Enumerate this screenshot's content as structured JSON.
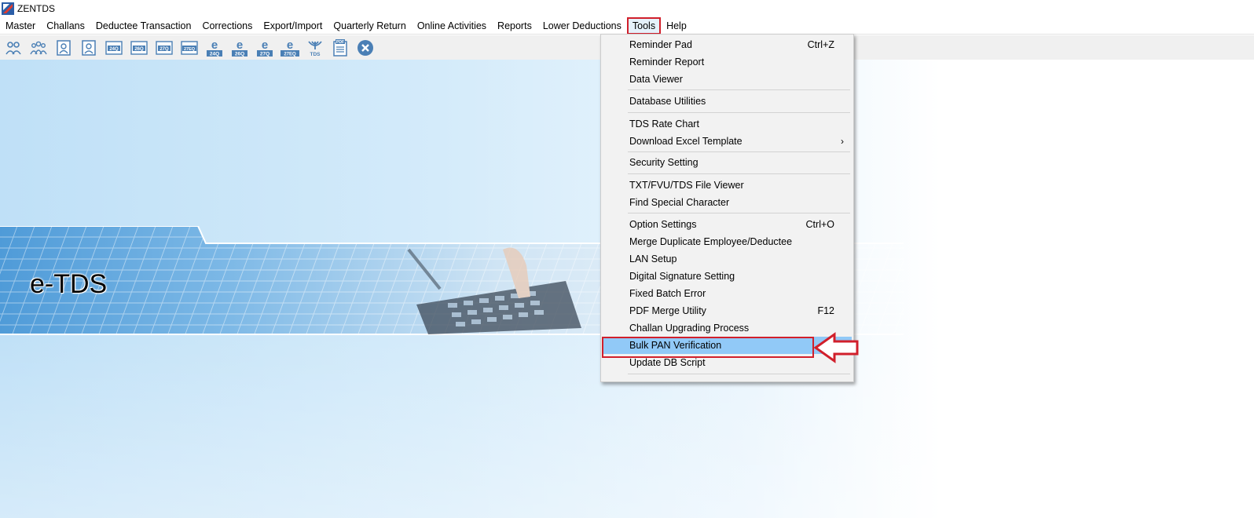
{
  "window": {
    "title": "ZENTDS"
  },
  "menubar": {
    "items": [
      "Master",
      "Challans",
      "Deductee Transaction",
      "Corrections",
      "Export/Import",
      "Quarterly Return",
      "Online Activities",
      "Reports",
      "Lower Deductions",
      "Tools",
      "Help"
    ],
    "active": "Tools"
  },
  "toolbar": {
    "icons": [
      {
        "name": "users-pair-icon",
        "label": ""
      },
      {
        "name": "users-group-icon",
        "label": ""
      },
      {
        "name": "deductee-icon",
        "label": ""
      },
      {
        "name": "employee-icon",
        "label": ""
      },
      {
        "name": "form-24q-icon",
        "label": "24Q"
      },
      {
        "name": "form-26q-icon",
        "label": "26Q"
      },
      {
        "name": "form-27q-icon",
        "label": "27Q"
      },
      {
        "name": "form-27eq-icon",
        "label": "27EQ"
      },
      {
        "name": "e-24q-icon",
        "label": "24Q"
      },
      {
        "name": "e-26q-icon",
        "label": "26Q"
      },
      {
        "name": "e-27q-icon",
        "label": "27Q"
      },
      {
        "name": "e-27eq-icon",
        "label": "27EQ"
      },
      {
        "name": "tds-icon",
        "label": "TDS"
      },
      {
        "name": "pdf-icon",
        "label": "PDF"
      },
      {
        "name": "close-icon",
        "label": ""
      }
    ]
  },
  "banner": {
    "title": "e-TDS"
  },
  "tools_menu": {
    "items": [
      {
        "label": "Reminder Pad",
        "shortcut": "Ctrl+Z"
      },
      {
        "label": "Reminder Report",
        "shortcut": ""
      },
      {
        "label": "Data Viewer",
        "shortcut": ""
      },
      {
        "label": "Database Utilities",
        "shortcut": ""
      },
      {
        "label": "TDS Rate Chart",
        "shortcut": ""
      },
      {
        "label": "Download Excel Template",
        "shortcut": "",
        "submenu": "›"
      },
      {
        "label": "Security Setting",
        "shortcut": ""
      },
      {
        "label": "TXT/FVU/TDS File Viewer",
        "shortcut": ""
      },
      {
        "label": "Find Special Character",
        "shortcut": ""
      },
      {
        "label": "Option Settings",
        "shortcut": "Ctrl+O"
      },
      {
        "label": "Merge Duplicate Employee/Deductee",
        "shortcut": ""
      },
      {
        "label": "LAN Setup",
        "shortcut": ""
      },
      {
        "label": "Digital Signature Setting",
        "shortcut": ""
      },
      {
        "label": "Fixed Batch Error",
        "shortcut": ""
      },
      {
        "label": "PDF Merge Utility",
        "shortcut": "F12"
      },
      {
        "label": "Challan Upgrading Process",
        "shortcut": ""
      },
      {
        "label": "Bulk PAN Verification",
        "shortcut": "",
        "highlighted": true
      },
      {
        "label": "Update DB Script",
        "shortcut": ""
      }
    ]
  },
  "colors": {
    "highlight": "#91c9f7",
    "annotation_red": "#d11f2b",
    "icon_blue": "#4a7fb5"
  }
}
